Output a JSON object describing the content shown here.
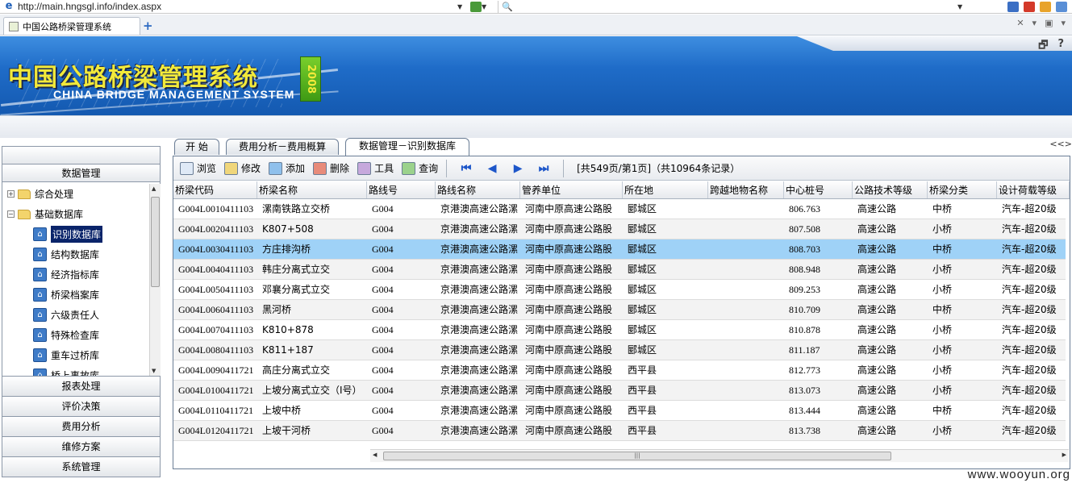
{
  "browser": {
    "url": "http://main.hngsgl.info/index.aspx",
    "tab_title": "中国公路桥梁管理系统",
    "new_tab": "+"
  },
  "banner": {
    "title_cn": "中国公路桥梁管理系统",
    "title_en": "CHINA BRIDGE MANAGEMENT SYSTEM",
    "year": "2008",
    "restore_glyph": "🗗",
    "help_glyph": "?"
  },
  "sidebar": {
    "top_header": "数据管理",
    "tree": [
      {
        "label": "综合处理",
        "toggle": "+"
      },
      {
        "label": "基础数据库",
        "toggle": "−"
      }
    ],
    "children": [
      {
        "label": "识别数据库",
        "selected": true
      },
      {
        "label": "结构数据库"
      },
      {
        "label": "经济指标库"
      },
      {
        "label": "桥梁档案库"
      },
      {
        "label": "六级责任人"
      },
      {
        "label": "特殊检查库"
      },
      {
        "label": "重车过桥库"
      },
      {
        "label": "桥上事故库"
      }
    ],
    "bottom": [
      "报表处理",
      "评价决策",
      "费用分析",
      "维修方案",
      "系统管理"
    ]
  },
  "content_tabs": [
    "开  始",
    "费用分析－费用概算",
    "数据管理－识别数据库"
  ],
  "tab_scroll": "<<>",
  "toolbar": {
    "buttons": [
      "浏览",
      "修改",
      "添加",
      "删除",
      "工具",
      "查询"
    ],
    "page_info": "[共549页/第1页]（共10964条记录）"
  },
  "grid": {
    "columns": [
      "桥梁代码",
      "桥梁名称",
      "路线号",
      "路线名称",
      "管养单位",
      "所在地",
      "跨越地物名称",
      "中心桩号",
      "公路技术等级",
      "桥梁分类",
      "设计荷载等级"
    ],
    "rows": [
      [
        "G004L0010411103",
        "漯南铁路立交桥",
        "G004",
        "京港澳高速公路漯",
        "河南中原高速公路股",
        "郾城区",
        "",
        "806.763",
        "高速公路",
        "中桥",
        "汽车-超20级"
      ],
      [
        "G004L0020411103",
        "K807+508",
        "G004",
        "京港澳高速公路漯",
        "河南中原高速公路股",
        "郾城区",
        "",
        "807.508",
        "高速公路",
        "小桥",
        "汽车-超20级"
      ],
      [
        "G004L0030411103",
        "方庄排沟桥",
        "G004",
        "京港澳高速公路漯",
        "河南中原高速公路股",
        "郾城区",
        "",
        "808.703",
        "高速公路",
        "中桥",
        "汽车-超20级"
      ],
      [
        "G004L0040411103",
        "韩庄分离式立交",
        "G004",
        "京港澳高速公路漯",
        "河南中原高速公路股",
        "郾城区",
        "",
        "808.948",
        "高速公路",
        "小桥",
        "汽车-超20级"
      ],
      [
        "G004L0050411103",
        "邓襄分离式立交",
        "G004",
        "京港澳高速公路漯",
        "河南中原高速公路股",
        "郾城区",
        "",
        "809.253",
        "高速公路",
        "小桥",
        "汽车-超20级"
      ],
      [
        "G004L0060411103",
        "黑河桥",
        "G004",
        "京港澳高速公路漯",
        "河南中原高速公路股",
        "郾城区",
        "",
        "810.709",
        "高速公路",
        "中桥",
        "汽车-超20级"
      ],
      [
        "G004L0070411103",
        "K810+878",
        "G004",
        "京港澳高速公路漯",
        "河南中原高速公路股",
        "郾城区",
        "",
        "810.878",
        "高速公路",
        "小桥",
        "汽车-超20级"
      ],
      [
        "G004L0080411103",
        "K811+187",
        "G004",
        "京港澳高速公路漯",
        "河南中原高速公路股",
        "郾城区",
        "",
        "811.187",
        "高速公路",
        "小桥",
        "汽车-超20级"
      ],
      [
        "G004L0090411721",
        "高庄分离式立交",
        "G004",
        "京港澳高速公路漯",
        "河南中原高速公路股",
        "西平县",
        "",
        "812.773",
        "高速公路",
        "小桥",
        "汽车-超20级"
      ],
      [
        "G004L0100411721",
        "上坡分离式立交（I号）",
        "G004",
        "京港澳高速公路漯",
        "河南中原高速公路股",
        "西平县",
        "",
        "813.073",
        "高速公路",
        "小桥",
        "汽车-超20级"
      ],
      [
        "G004L0110411721",
        "上坡中桥",
        "G004",
        "京港澳高速公路漯",
        "河南中原高速公路股",
        "西平县",
        "",
        "813.444",
        "高速公路",
        "中桥",
        "汽车-超20级"
      ],
      [
        "G004L0120411721",
        "上坡干河桥",
        "G004",
        "京港澳高速公路漯",
        "河南中原高速公路股",
        "西平县",
        "",
        "813.738",
        "高速公路",
        "小桥",
        "汽车-超20级"
      ]
    ],
    "selected_row": 2
  },
  "watermark": "www.wooyun.org",
  "colors": {
    "selection": "#9fd2f7",
    "tree_selection": "#0a246a",
    "banner": "#1f6cc8",
    "title": "#f2e93a"
  }
}
